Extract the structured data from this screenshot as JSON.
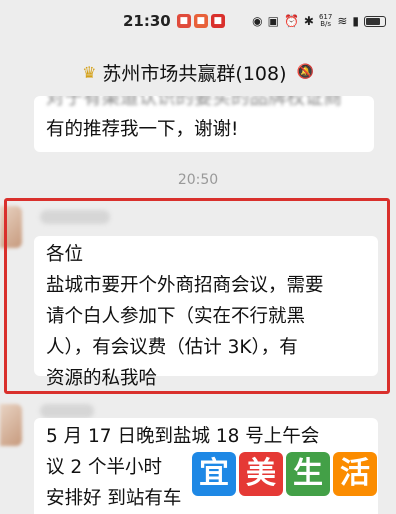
{
  "status_bar": {
    "time": "21:30",
    "net_speed_value": "617",
    "net_speed_unit": "B/s"
  },
  "header": {
    "title": "苏州市场共赢群(108)",
    "crown_icon": "crown-icon",
    "mute_icon": "bell-muted-icon"
  },
  "messages": [
    {
      "cut_line": "对于有渠道认识的要买的品牌权证商",
      "lines": [
        "有的推荐我一下，谢谢!"
      ]
    },
    {
      "lines": [
        "各位",
        "盐城市要开个外商招商会议，需要",
        "请个白人参加下（实在不行就黑",
        "人），有会议费（估计 3K），有",
        "资源的私我哈"
      ]
    },
    {
      "lines": [
        "5 月 17 日晚到盐城 18 号上午会",
        "议 2 个半小时",
        "安排好 到站有车"
      ]
    }
  ],
  "time_divider": "20:50",
  "watermark": {
    "chars": [
      "宜",
      "美",
      "生",
      "活"
    ],
    "colors": [
      "#1e88e5",
      "#e53935",
      "#43a047",
      "#fb8c00"
    ]
  },
  "colors": {
    "highlight": "#d9302c",
    "background": "#ededed"
  }
}
